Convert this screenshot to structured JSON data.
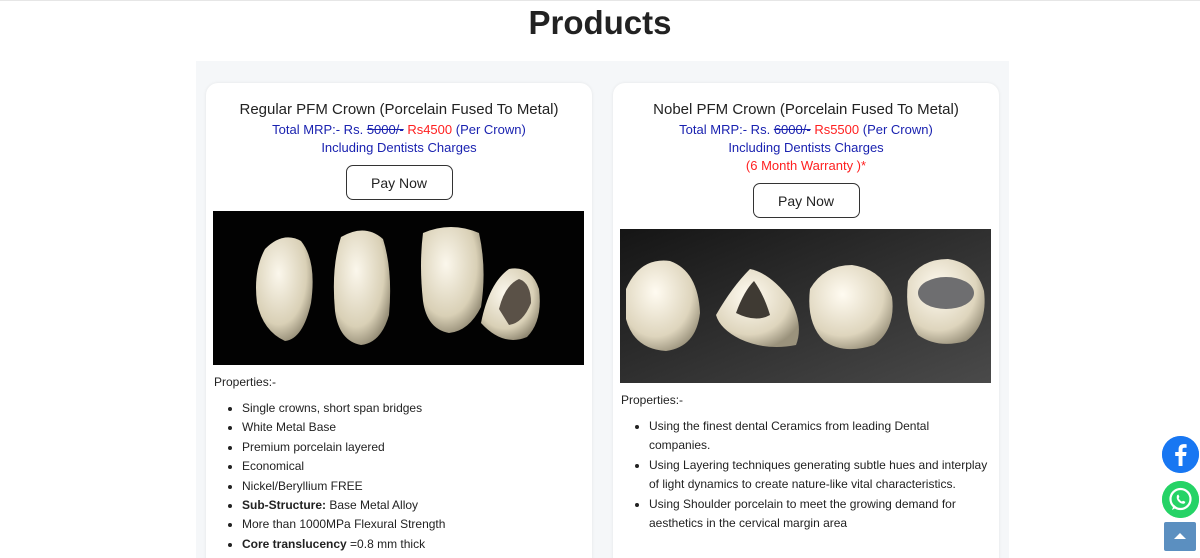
{
  "page": {
    "title": "Products"
  },
  "products": [
    {
      "name": "Regular PFM Crown (Porcelain Fused To Metal)",
      "price_prefix": "Total MRP:- Rs.",
      "price_old": "5000/-",
      "price_new": "Rs4500",
      "price_suffix": "(Per Crown)",
      "charges": "Including Dentists Charges",
      "pay_label": "Pay Now",
      "properties_label": "Properties:-",
      "properties": [
        {
          "bold": "",
          "text": "Single crowns, short span bridges"
        },
        {
          "bold": "",
          "text": "White Metal Base"
        },
        {
          "bold": "",
          "text": "Premium porcelain layered"
        },
        {
          "bold": "",
          "text": "Economical"
        },
        {
          "bold": "",
          "text": "Nickel/Beryllium FREE"
        },
        {
          "bold": "Sub-Structure:",
          "text": " Base Metal Alloy"
        },
        {
          "bold": "",
          "text": "More than 1000MPa Flexural Strength"
        },
        {
          "bold": "Core translucency",
          "text": " =0.8 mm thick"
        }
      ]
    },
    {
      "name": "Nobel PFM Crown (Porcelain Fused To Metal)",
      "price_prefix": "Total MRP:- Rs.",
      "price_old": "6000/-",
      "price_new": "Rs5500",
      "price_suffix": "(Per Crown)",
      "charges": "Including Dentists Charges",
      "warranty": "(6 Month Warranty )*",
      "pay_label": "Pay Now",
      "properties_label": "Properties:-",
      "properties": [
        {
          "bold": "",
          "text": "Using the finest dental Ceramics from leading Dental companies."
        },
        {
          "bold": "",
          "text": "Using Layering techniques generating subtle hues and interplay of light dynamics to create nature-like vital characteristics."
        },
        {
          "bold": "",
          "text": "Using Shoulder porcelain to meet the growing demand for aesthetics in the cervical margin area"
        }
      ]
    }
  ],
  "floating": {
    "facebook_icon": "facebook-icon",
    "whatsapp_icon": "whatsapp-icon",
    "scroll_top_icon": "chevron-up-icon"
  },
  "colors": {
    "price_blue": "#1a22b0",
    "price_red": "#ff1f1f",
    "facebook": "#1877f2",
    "whatsapp": "#25d366",
    "scroll_top": "#5b8fc0"
  }
}
